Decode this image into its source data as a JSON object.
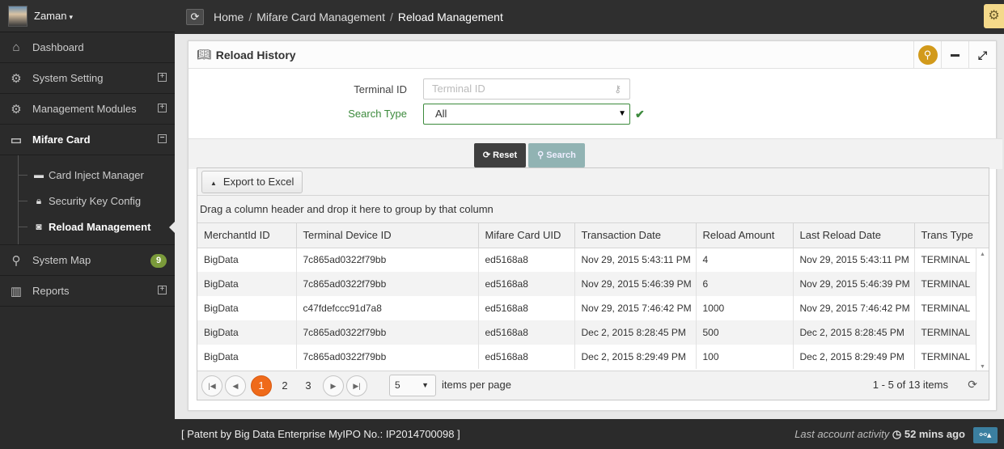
{
  "user": {
    "name": "Zaman"
  },
  "sidebar": {
    "items": [
      {
        "label": "Dashboard",
        "icon": "home-icon"
      },
      {
        "label": "System Setting",
        "icon": "gears-icon"
      },
      {
        "label": "Management Modules",
        "icon": "gears-icon"
      },
      {
        "label": "Mifare Card",
        "icon": "credit-card-icon"
      },
      {
        "label": "System Map",
        "icon": "map-marker-icon",
        "badge": "9"
      },
      {
        "label": "Reports",
        "icon": "bar-chart-icon"
      }
    ],
    "subitems": [
      {
        "label": "Card Inject Manager",
        "icon": "card-icon"
      },
      {
        "label": "Security Key Config",
        "icon": "lock-icon"
      },
      {
        "label": "Reload Management",
        "icon": "money-icon"
      }
    ]
  },
  "breadcrumb": {
    "home": "Home",
    "section": "Mifare Card Management",
    "current": "Reload Management"
  },
  "panel": {
    "title": "Reload History"
  },
  "form": {
    "terminal_label": "Terminal ID",
    "terminal_placeholder": "Terminal ID",
    "search_type_label": "Search Type",
    "search_type_value": "All",
    "reset_label": "Reset",
    "search_label": "Search"
  },
  "grid": {
    "export_label": "Export to Excel",
    "group_hint": "Drag a column header and drop it here to group by that column",
    "columns": [
      "MerchantId ID",
      "Terminal Device ID",
      "Mifare Card UID",
      "Transaction Date",
      "Reload Amount",
      "Last Reload Date",
      "Trans Type"
    ],
    "rows": [
      [
        "BigData",
        "7c865ad0322f79bb",
        "ed5168a8",
        "Nov 29, 2015 5:43:11 PM",
        "4",
        "Nov 29, 2015 5:43:11 PM",
        "TERMINAL"
      ],
      [
        "BigData",
        "7c865ad0322f79bb",
        "ed5168a8",
        "Nov 29, 2015 5:46:39 PM",
        "6",
        "Nov 29, 2015 5:46:39 PM",
        "TERMINAL"
      ],
      [
        "BigData",
        "c47fdefccc91d7a8",
        "ed5168a8",
        "Nov 29, 2015 7:46:42 PM",
        "1000",
        "Nov 29, 2015 7:46:42 PM",
        "TERMINAL"
      ],
      [
        "BigData",
        "7c865ad0322f79bb",
        "ed5168a8",
        "Dec 2, 2015 8:28:45 PM",
        "500",
        "Dec 2, 2015 8:28:45 PM",
        "TERMINAL"
      ],
      [
        "BigData",
        "7c865ad0322f79bb",
        "ed5168a8",
        "Dec 2, 2015 8:29:49 PM",
        "100",
        "Dec 2, 2015 8:29:49 PM",
        "TERMINAL"
      ]
    ]
  },
  "pager": {
    "pages": [
      "1",
      "2",
      "3"
    ],
    "current_page": "1",
    "page_size": "5",
    "per_page_label": "items per page",
    "info": "1 - 5 of 13 items"
  },
  "footer": {
    "patent": "[ Patent by Big Data Enterprise  MyIPO No.: IP2014700098 ]",
    "activity_label": "Last account activity",
    "activity_value": "52 mins ago"
  },
  "colors": {
    "accent": "#ef6a1a",
    "valid": "#3c8a3c",
    "search_icon_bg": "#d29a1b"
  }
}
